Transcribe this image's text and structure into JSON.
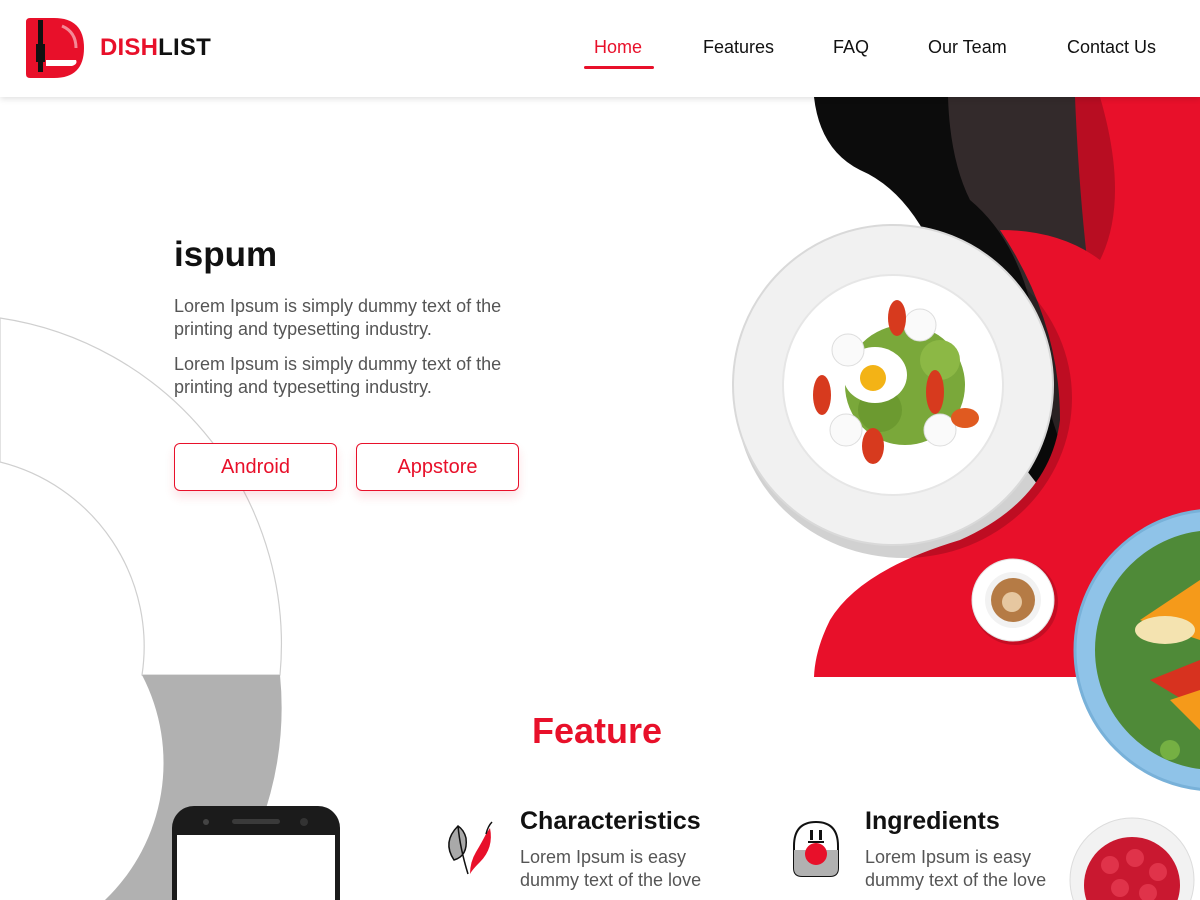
{
  "brand": {
    "part1": "DISH",
    "part2": "LIST"
  },
  "nav": {
    "items": [
      {
        "label": "Home",
        "active": true
      },
      {
        "label": "Features",
        "active": false
      },
      {
        "label": "FAQ",
        "active": false
      },
      {
        "label": "Our Team",
        "active": false
      },
      {
        "label": "Contact Us",
        "active": false
      }
    ]
  },
  "hero": {
    "title": "ispum",
    "paragraphs": [
      "Lorem Ipsum is simply dummy text of the printing and typesetting industry.",
      "Lorem Ipsum is simply dummy text of the printing and typesetting industry."
    ],
    "buttons": {
      "android": "Android",
      "appstore": "Appstore"
    }
  },
  "feature": {
    "title": "Feature",
    "items": [
      {
        "heading": "Characteristics",
        "text": "Lorem Ipsum is easy dummy text of the love",
        "icon": "chili-leaf-icon"
      },
      {
        "heading": "Ingredients",
        "text": "Lorem Ipsum is easy dummy text of the love",
        "icon": "chef-hat-icon"
      }
    ]
  },
  "colors": {
    "accent": "#e8102a",
    "dark": "#111111",
    "text_muted": "#555555"
  }
}
